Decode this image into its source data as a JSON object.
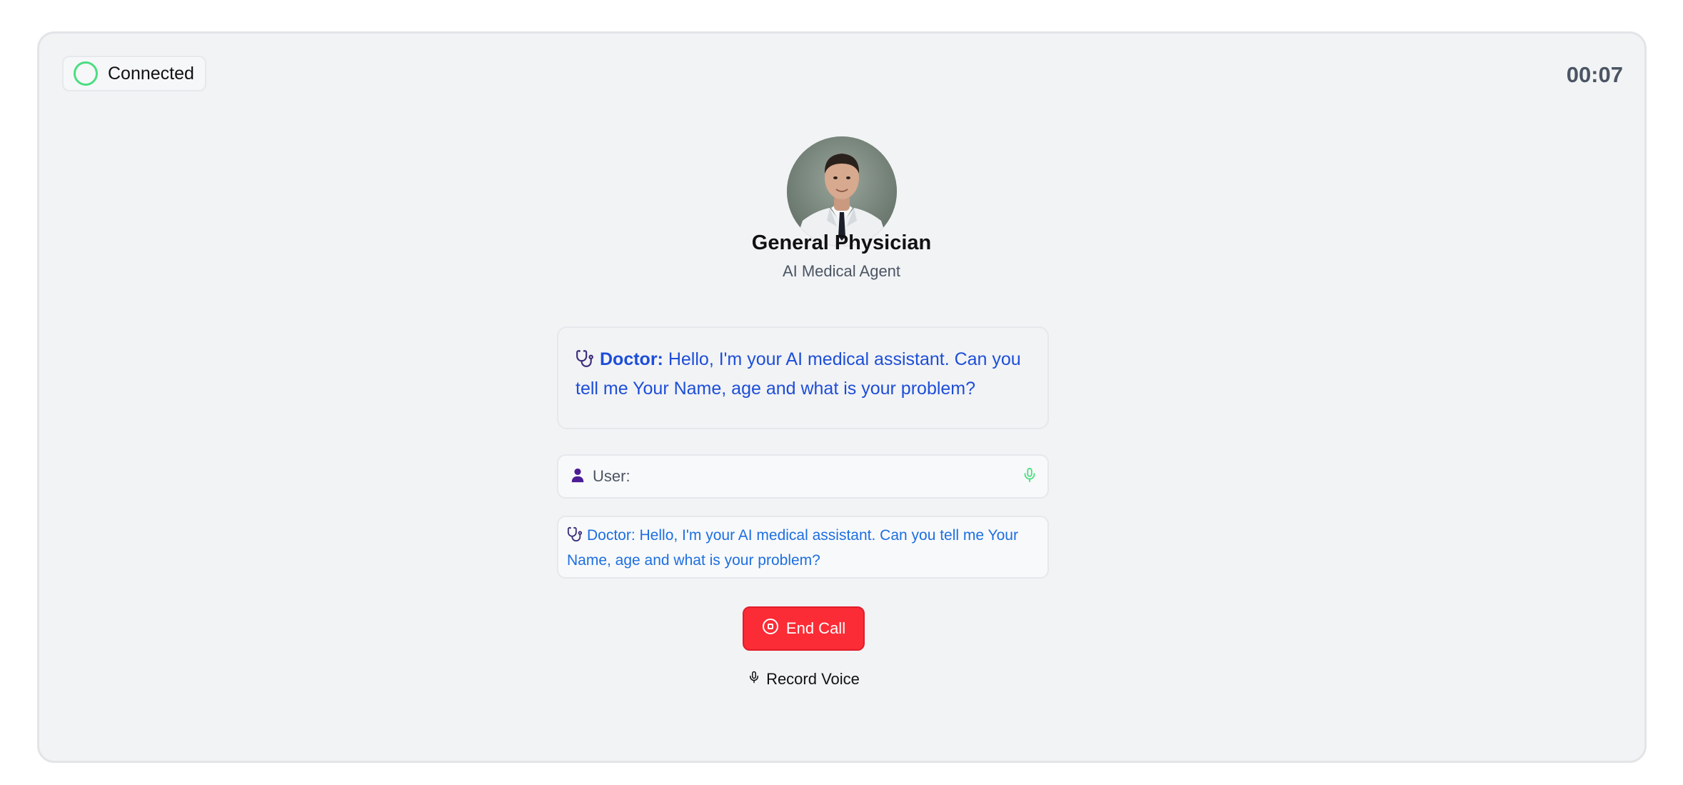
{
  "status": {
    "label": "Connected",
    "color": "#4ade80"
  },
  "timer": "00:07",
  "agent": {
    "title": "General Physician",
    "subtitle": "AI Medical Agent",
    "avatar_icon": "doctor-portrait"
  },
  "message": {
    "speaker": "Doctor:",
    "text": "Hello, I'm your AI medical assistant. Can you tell me Your Name, age and what is your problem?",
    "icon": "stethoscope-icon"
  },
  "user_row": {
    "label": "User:",
    "icon": "user-icon",
    "mic_icon": "mic-icon"
  },
  "transcript": {
    "text": "Doctor: Hello, I'm your AI medical assistant. Can you tell me Your Name, age and what is your problem?"
  },
  "actions": {
    "end_call_label": "End Call",
    "record_label": "Record Voice"
  },
  "colors": {
    "accent_blue": "#1d4ed8",
    "end_call_red": "#fb2c36",
    "panel_bg": "#f2f3f5"
  }
}
